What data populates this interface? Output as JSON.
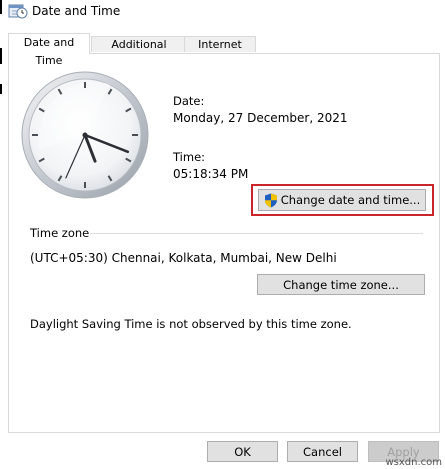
{
  "window": {
    "title": "Date and Time"
  },
  "tabs": [
    {
      "label": "Date and Time"
    },
    {
      "label": "Additional Clocks"
    },
    {
      "label": "Internet Time"
    }
  ],
  "date": {
    "label": "Date:",
    "value": "Monday, 27 December, 2021"
  },
  "time": {
    "label": "Time:",
    "value": "05:18:34 PM"
  },
  "buttons": {
    "change_datetime": "Change date and time...",
    "change_timezone": "Change time zone...",
    "ok": "OK",
    "cancel": "Cancel",
    "apply": "Apply"
  },
  "timezone": {
    "header": "Time zone",
    "value": "(UTC+05:30) Chennai, Kolkata, Mumbai, New Delhi"
  },
  "dst_note": "Daylight Saving Time is not observed by this time zone.",
  "watermark": "wsxdn.com",
  "clock": {
    "hours": 5,
    "minutes": 18,
    "seconds": 34
  },
  "colors": {
    "highlight": "#c9252b",
    "focus": "#0078d7"
  }
}
